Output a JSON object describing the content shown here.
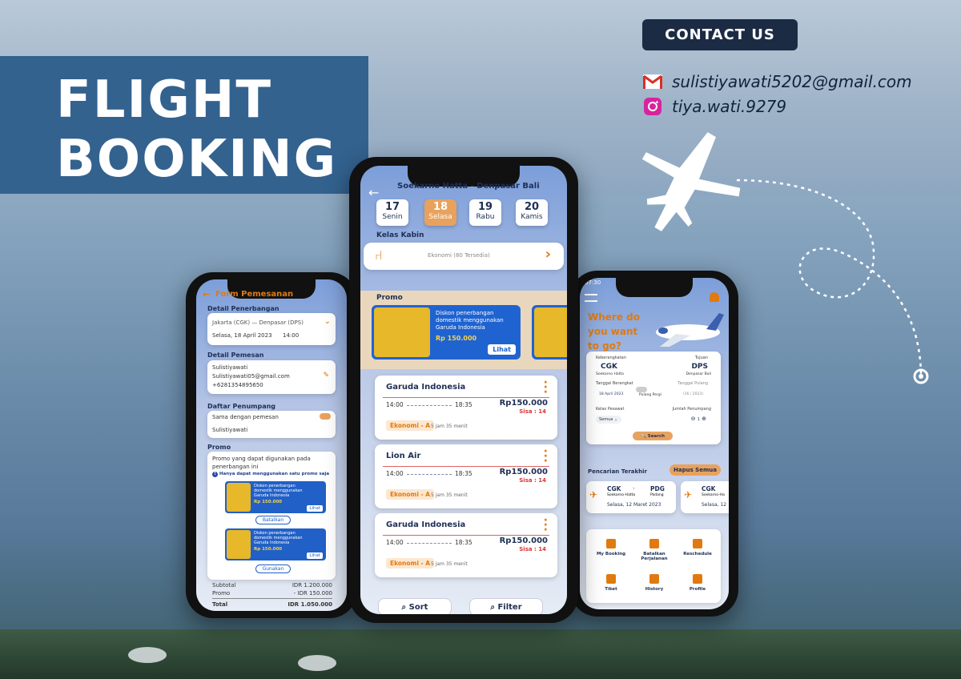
{
  "poster": {
    "title_line1": "FLIGHT",
    "title_line2": "BOOKING",
    "contact_label": "CONTACT US",
    "email": "sulistiyawati5202@gmail.com",
    "instagram": "tiya.wati.9279",
    "accent": "#e07a10",
    "navy": "#1c2b44",
    "title_bg": "#33628f"
  },
  "left": {
    "header": "Form Pemesanan",
    "sec_penerbangan": "Detail Penerbangan",
    "route": "Jakarta (CGK) — Denpasar (DPS)",
    "date": "Selasa, 18 April 2023",
    "time": "14:00",
    "sec_pemesan": "Detail Pemesan",
    "name": "Sulistiyawati",
    "email": "Sulistiyawati05@gmail.com",
    "phone": "+6281354895650",
    "sec_penumpang": "Daftar Penumpang",
    "same_label": "Sama dengan pemesan",
    "passenger": "Sulistiyawati",
    "sec_promo": "Promo",
    "promo_desc": "Promo yang dapat digunakan pada penerbangan ini",
    "promo_note": "Hanya dapat menggunakan satu promo saja",
    "promo_text": "Diskon penerbangan domestik menggunakan Garuda Indonesia",
    "promo_price": "Rp 150.000",
    "lihat": "Lihat",
    "batalkan": "Batalkan",
    "gunakan": "Gunakan",
    "subtotal_label": "Subtotal",
    "subtotal": "IDR 1.200.000",
    "promo_label": "Promo",
    "promo_val": "- IDR 150.000",
    "total_label": "Total",
    "total": "IDR 1.050.000"
  },
  "middle": {
    "status_time": "07:30",
    "header": "Soekarno Hatta - Denpasar Bali",
    "days": [
      {
        "n": "17",
        "d": "Senin"
      },
      {
        "n": "18",
        "d": "Selasa"
      },
      {
        "n": "19",
        "d": "Rabu"
      },
      {
        "n": "20",
        "d": "Kamis"
      }
    ],
    "kelas_label": "Kelas Kabin",
    "kelas_value": "Ekonomi (80 Tersedia)",
    "promo_label": "Promo",
    "promo_text": "Diskon penerbangan domestik menggunakan Garuda Indonesia",
    "promo_price": "Rp 150.000",
    "lihat": "Lihat",
    "flights": [
      {
        "airline": "Garuda Indonesia",
        "dep": "14:00",
        "arr": "18:35",
        "price": "Rp150.000",
        "seat": "Sisa : 14",
        "cls": "Ekonomi - A",
        "dur": "5 jam 35 menit"
      },
      {
        "airline": "Lion Air",
        "dep": "14:00",
        "arr": "18:35",
        "price": "Rp150.000",
        "seat": "Sisa : 14",
        "cls": "Ekonomi - A",
        "dur": "5 jam 35 menit"
      },
      {
        "airline": "Garuda Indonesia",
        "dep": "14:00",
        "arr": "18:35",
        "price": "Rp150.000",
        "seat": "Sisa : 14",
        "cls": "Ekonomi - A",
        "dur": "5 jam 35 menit"
      }
    ],
    "sort": "Sort",
    "filter": "Filter"
  },
  "right": {
    "status_time": "07:30",
    "headline": "Where do you want to go?",
    "from_label": "Keberangkatan",
    "to_label": "Tujuan",
    "from_code": "CGK",
    "from_name": "Soekarno Hatta",
    "to_code": "DPS",
    "to_name": "Denpasar Bali",
    "dep_label": "Tanggal Berangkat",
    "ret_label": "Tanggal Pulang",
    "dep_date": "18 April 2023",
    "pp_label": "Pulang Pergi",
    "ret_date": "(16 / 2023)",
    "kelas_label": "Kelas Pesawat",
    "jumlah_label": "Jumlah Penumpang",
    "kelas_value": "Semua",
    "count": "1",
    "search": "Search",
    "recent_label": "Pencarian Terakhir",
    "hapus": "Hapus Semua",
    "recent": [
      {
        "from": "CGK",
        "from_name": "Soekarno-Hatta",
        "to": "PDG",
        "to_name": "Padang",
        "date": "Selasa, 12 Maret 2023"
      },
      {
        "from": "CGK",
        "from_name": "Soekarno-Ha",
        "to": "",
        "to_name": "",
        "date": "Selasa, 12"
      }
    ],
    "menu": [
      "My Booking",
      "Batalkan Perjalanan",
      "Reschedule",
      "Tiket",
      "History",
      "Profile"
    ]
  }
}
